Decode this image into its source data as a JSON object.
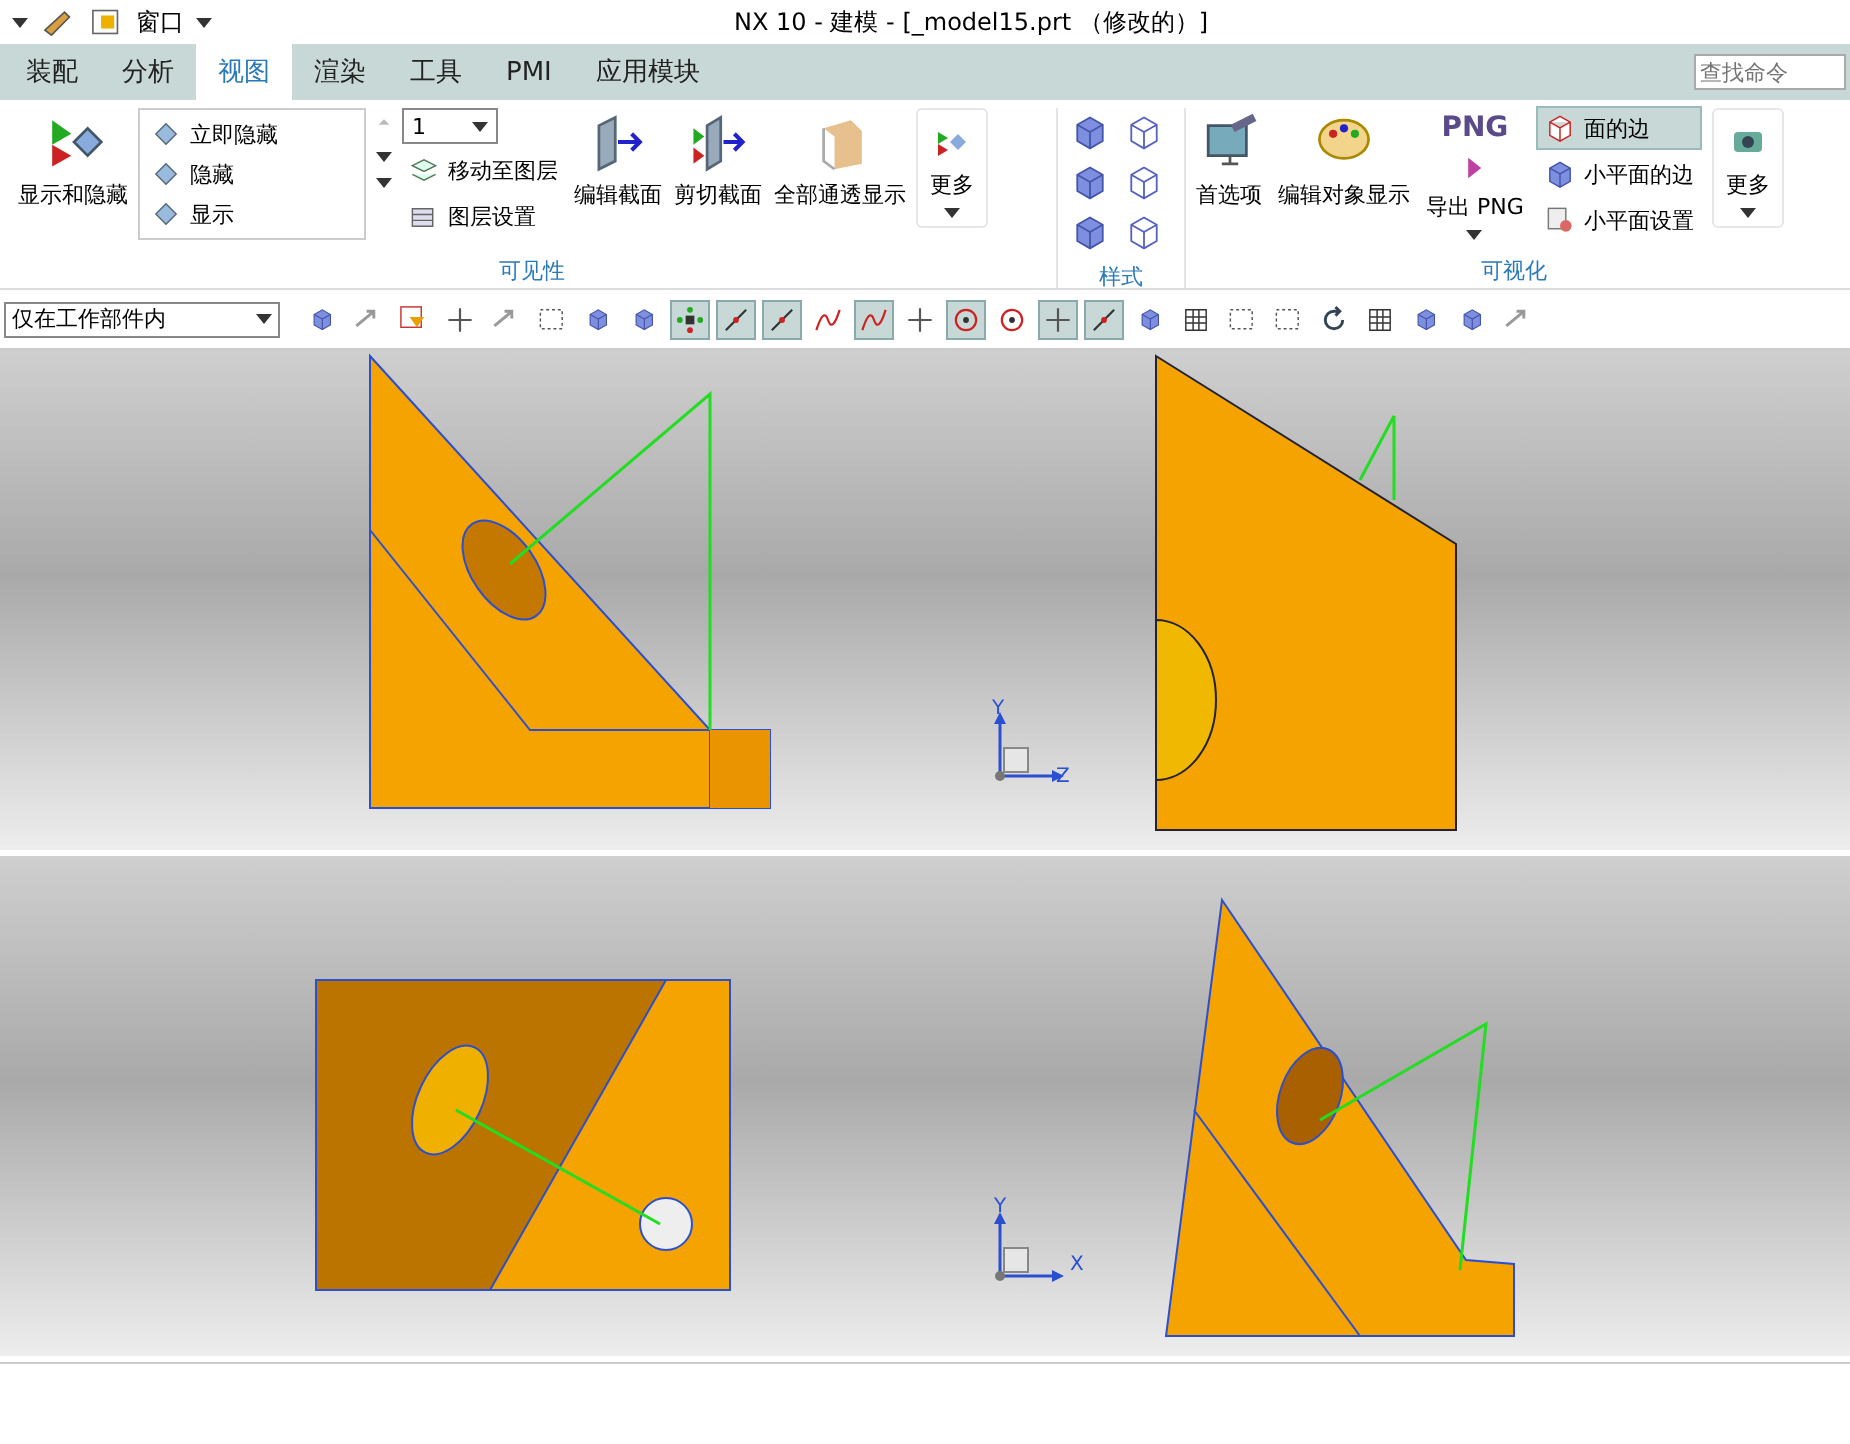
{
  "quick_access": {
    "window_menu": "窗口"
  },
  "window": {
    "title": "NX 10 - 建模 - [_model15.prt （修改的）]"
  },
  "tabs": [
    {
      "label": "装配",
      "selected": false
    },
    {
      "label": "分析",
      "selected": false
    },
    {
      "label": "视图",
      "selected": true
    },
    {
      "label": "渲染",
      "selected": false
    },
    {
      "label": "工具",
      "selected": false
    },
    {
      "label": "PMI",
      "selected": false
    },
    {
      "label": "应用模块",
      "selected": false
    }
  ],
  "search": {
    "placeholder": "查找命令"
  },
  "ribbon": {
    "visibility": {
      "label": "可见性",
      "show_hide": "显示和隐藏",
      "list": [
        "立即隐藏",
        "隐藏",
        "显示"
      ],
      "layer": "1",
      "move_layer": "移动至图层",
      "layer_settings": "图层设置",
      "edit_section": "编辑截面",
      "clip_section": "剪切截面",
      "see_through": "全部通透显示",
      "more": "更多"
    },
    "style": {
      "label": "样式"
    },
    "visualization": {
      "label": "可视化",
      "preferences": "首选项",
      "edit_display": "编辑对象显示",
      "png_glyph": "PNG",
      "export_png": "导出 PNG",
      "face_edges": {
        "label": "面的边",
        "selected": true
      },
      "facet_edges": "小平面的边",
      "facet_settings": "小平面设置",
      "more": "更多"
    }
  },
  "command_bar": {
    "filter": "仅在工作部件内",
    "tools": [
      {
        "kind": "cube",
        "selected": false
      },
      {
        "kind": "arrow",
        "selected": false
      },
      {
        "kind": "filter",
        "selected": false
      },
      {
        "kind": "cross",
        "selected": false
      },
      {
        "kind": "arrow",
        "selected": false
      },
      {
        "kind": "box",
        "selected": false
      },
      {
        "kind": "cube",
        "selected": false
      },
      {
        "kind": "cube",
        "selected": false
      },
      {
        "kind": "dots",
        "selected": true
      },
      {
        "kind": "line",
        "selected": true
      },
      {
        "kind": "line",
        "selected": true
      },
      {
        "kind": "curve",
        "selected": false
      },
      {
        "kind": "curve",
        "selected": true
      },
      {
        "kind": "cross",
        "selected": false
      },
      {
        "kind": "circle",
        "selected": true
      },
      {
        "kind": "circle",
        "selected": false
      },
      {
        "kind": "cross",
        "selected": true
      },
      {
        "kind": "line",
        "selected": true
      },
      {
        "kind": "cube",
        "selected": false
      },
      {
        "kind": "grid",
        "selected": false
      },
      {
        "kind": "box",
        "selected": false
      },
      {
        "kind": "box",
        "selected": false
      },
      {
        "kind": "rotate",
        "selected": false
      },
      {
        "kind": "grid",
        "selected": false
      },
      {
        "kind": "cube",
        "selected": false
      },
      {
        "kind": "cube",
        "selected": false
      },
      {
        "kind": "arrow",
        "selected": false
      }
    ]
  },
  "viewports": [
    {
      "triad": [
        "Y",
        "Z"
      ]
    },
    {
      "triad": [
        "Y",
        "X"
      ]
    }
  ]
}
